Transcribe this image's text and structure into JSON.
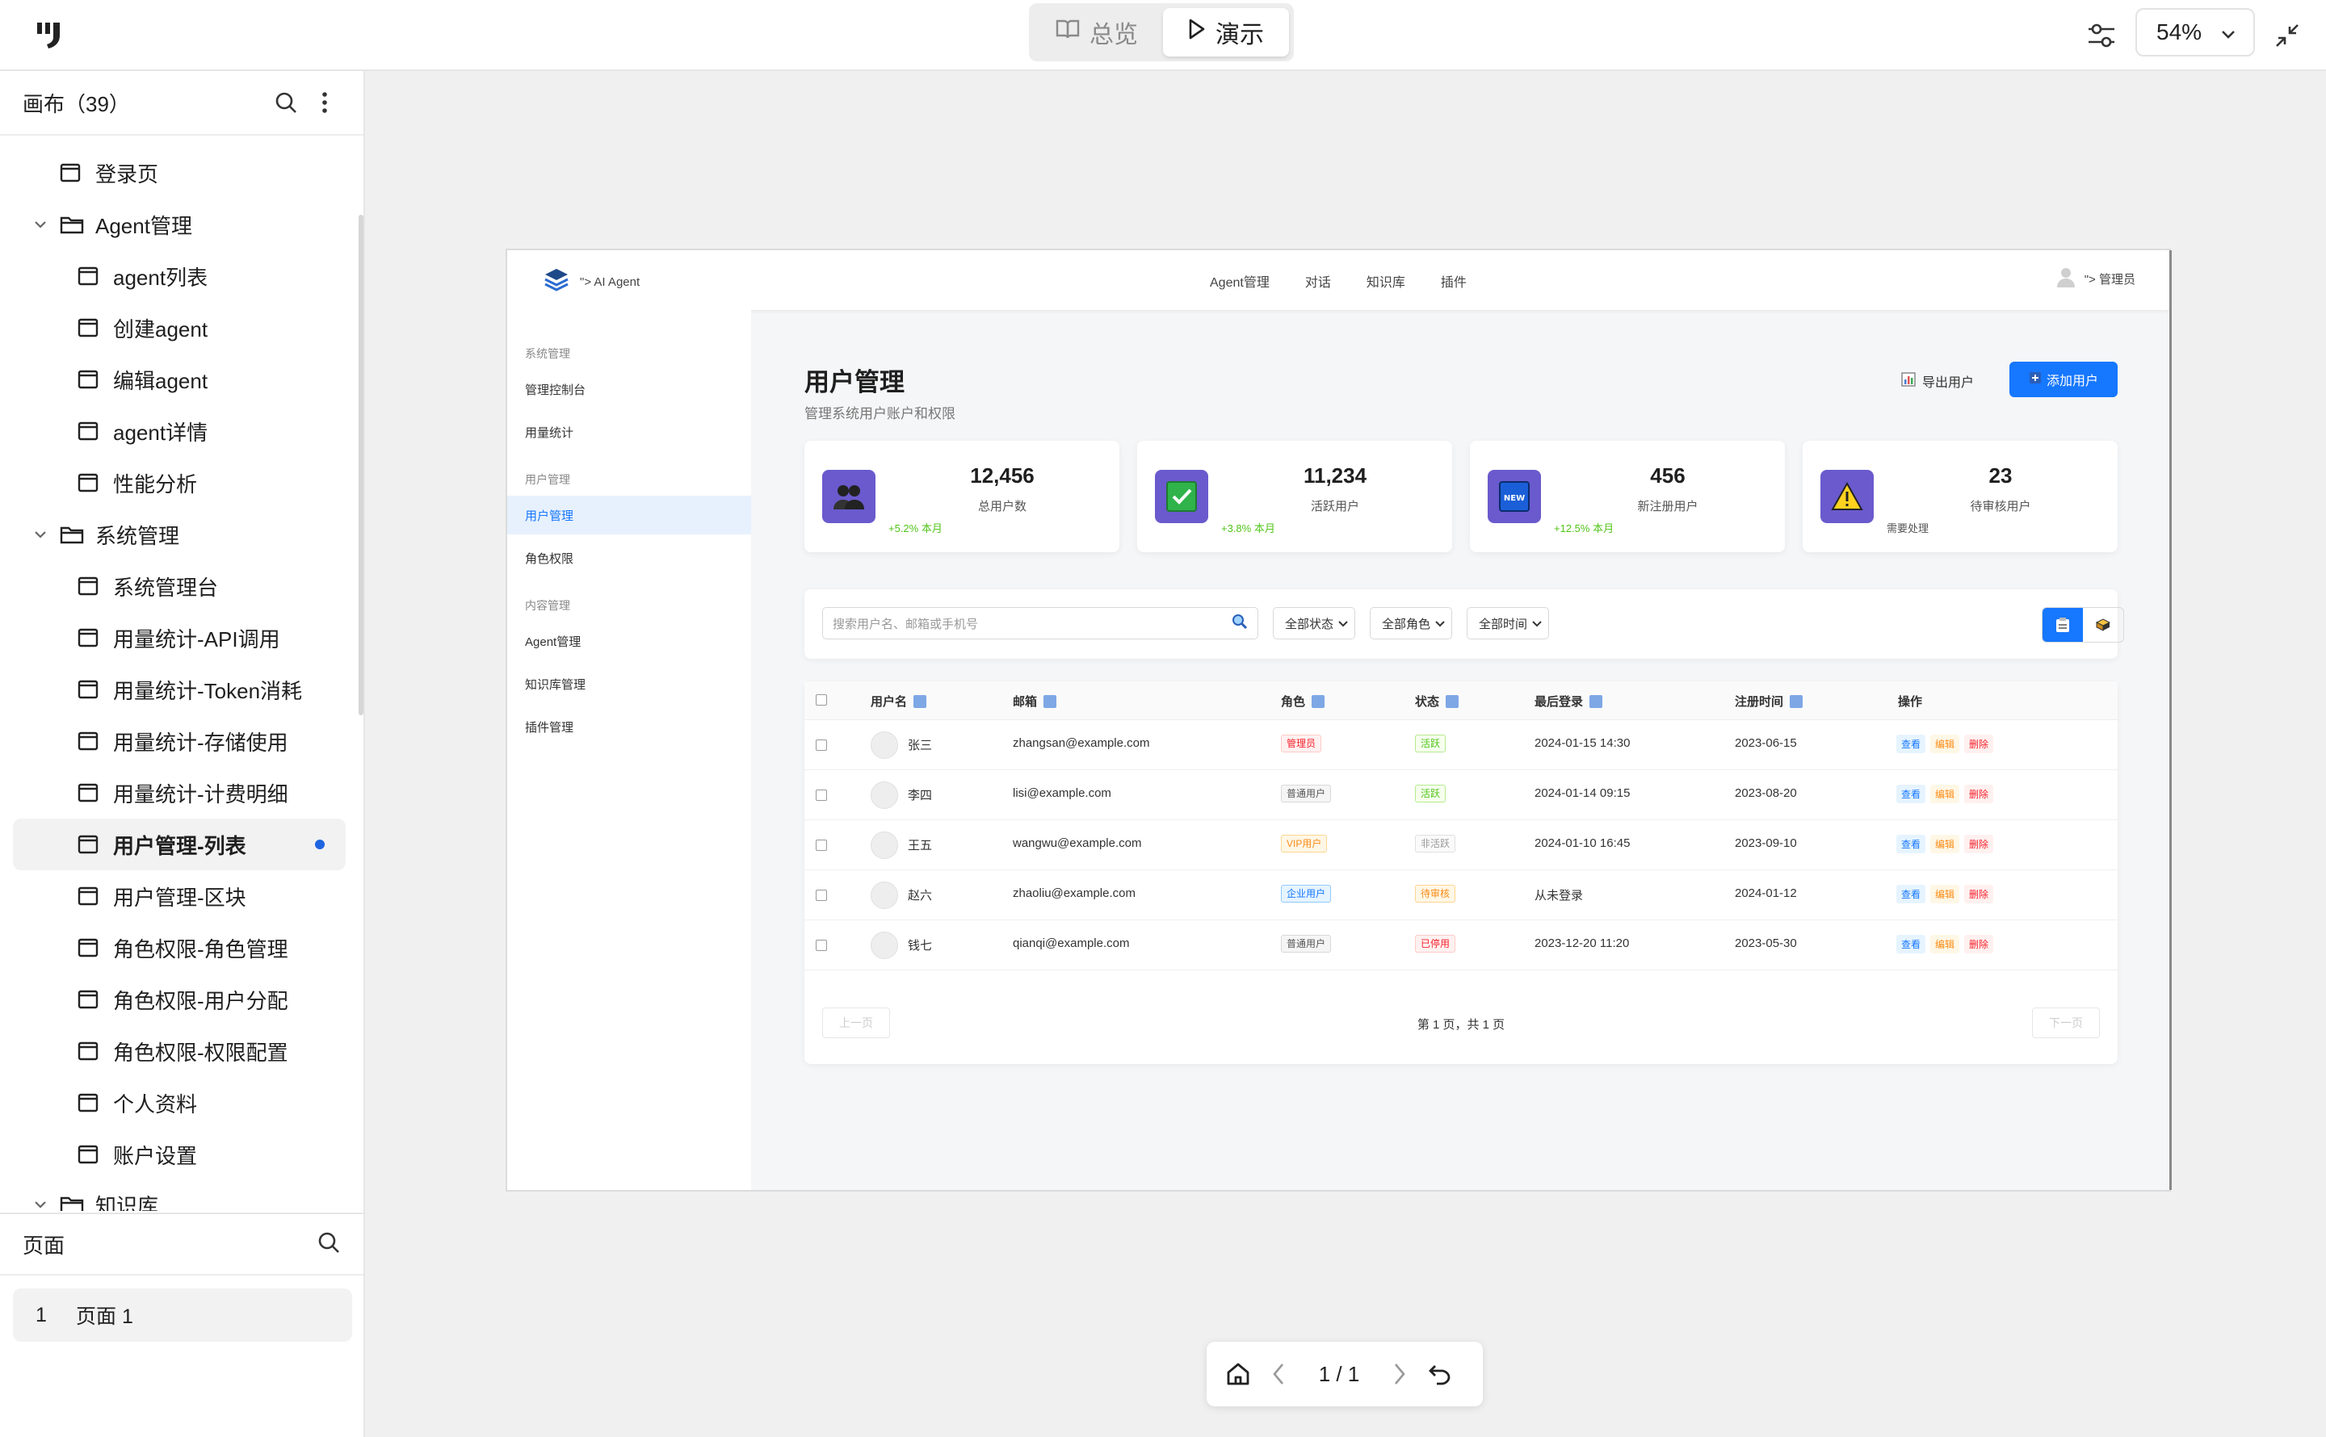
{
  "toolbar": {
    "overview_label": "总览",
    "present_label": "演示",
    "zoom": "54%"
  },
  "sidebar": {
    "canvas_title": "画布（39）",
    "tree": [
      {
        "label": "登录页",
        "type": "page",
        "level": 1
      },
      {
        "label": "Agent管理",
        "type": "folder",
        "level": 0
      },
      {
        "label": "agent列表",
        "type": "page",
        "level": 2
      },
      {
        "label": "创建agent",
        "type": "page",
        "level": 2
      },
      {
        "label": "编辑agent",
        "type": "page",
        "level": 2
      },
      {
        "label": "agent详情",
        "type": "page",
        "level": 2
      },
      {
        "label": "性能分析",
        "type": "page",
        "level": 2
      },
      {
        "label": "系统管理",
        "type": "folder",
        "level": 0
      },
      {
        "label": "系统管理台",
        "type": "page",
        "level": 2
      },
      {
        "label": "用量统计-API调用",
        "type": "page",
        "level": 2
      },
      {
        "label": "用量统计-Token消耗",
        "type": "page",
        "level": 2
      },
      {
        "label": "用量统计-存储使用",
        "type": "page",
        "level": 2
      },
      {
        "label": "用量统计-计费明细",
        "type": "page",
        "level": 2
      },
      {
        "label": "用户管理-列表",
        "type": "page",
        "level": 2,
        "active": true
      },
      {
        "label": "用户管理-区块",
        "type": "page",
        "level": 2
      },
      {
        "label": "角色权限-角色管理",
        "type": "page",
        "level": 2
      },
      {
        "label": "角色权限-用户分配",
        "type": "page",
        "level": 2
      },
      {
        "label": "角色权限-权限配置",
        "type": "page",
        "level": 2
      },
      {
        "label": "个人资料",
        "type": "page",
        "level": 2
      },
      {
        "label": "账户设置",
        "type": "page",
        "level": 2
      },
      {
        "label": "知识库",
        "type": "folder",
        "level": 0
      }
    ],
    "pages_title": "页面",
    "pages": [
      {
        "num": "1",
        "label": "页面 1"
      }
    ]
  },
  "artboard": {
    "brand": "\"> AI Agent",
    "nav": [
      "Agent管理",
      "对话",
      "知识库",
      "插件"
    ],
    "user": "\"> 管理员",
    "side_groups": [
      {
        "title": "系统管理",
        "items": [
          "管理控制台",
          "用量统计"
        ]
      },
      {
        "title": "用户管理",
        "items": [
          "用户管理",
          "角色权限"
        ]
      },
      {
        "title": "内容管理",
        "items": [
          "Agent管理",
          "知识库管理",
          "插件管理"
        ]
      }
    ],
    "page_title": "用户管理",
    "page_subtitle": "管理系统用户账户和权限",
    "export_label": "导出用户",
    "add_label": "添加用户",
    "stats": [
      {
        "value": "12,456",
        "label": "总用户数",
        "change": "+5.2% 本月",
        "icon": "users-icon"
      },
      {
        "value": "11,234",
        "label": "活跃用户",
        "change": "+3.8% 本月",
        "icon": "check-icon"
      },
      {
        "value": "456",
        "label": "新注册用户",
        "change": "+12.5% 本月",
        "icon": "new-icon"
      },
      {
        "value": "23",
        "label": "待审核用户",
        "change": "需要处理",
        "icon": "warning-icon"
      }
    ],
    "search_placeholder": "搜索用户名、邮箱或手机号",
    "filters": [
      "全部状态",
      "全部角色",
      "全部时间"
    ],
    "columns": [
      "用户名",
      "邮箱",
      "角色",
      "状态",
      "最后登录",
      "注册时间",
      "操作"
    ],
    "rows": [
      {
        "name": "张三",
        "email": "zhangsan@example.com",
        "role": "管理员",
        "role_color": "red",
        "status": "活跃",
        "status_color": "green",
        "last_login": "2024-01-15 14:30",
        "registered": "2023-06-15"
      },
      {
        "name": "李四",
        "email": "lisi@example.com",
        "role": "普通用户",
        "role_color": "gray",
        "status": "活跃",
        "status_color": "green",
        "last_login": "2024-01-14 09:15",
        "registered": "2023-08-20"
      },
      {
        "name": "王五",
        "email": "wangwu@example.com",
        "role": "VIP用户",
        "role_color": "gold",
        "status": "非活跃",
        "status_color": "lgray",
        "last_login": "2024-01-10 16:45",
        "registered": "2023-09-10"
      },
      {
        "name": "赵六",
        "email": "zhaoliu@example.com",
        "role": "企业用户",
        "role_color": "blue",
        "status": "待审核",
        "status_color": "gold",
        "last_login": "从未登录",
        "registered": "2024-01-12"
      },
      {
        "name": "钱七",
        "email": "qianqi@example.com",
        "role": "普通用户",
        "role_color": "gray",
        "status": "已停用",
        "status_color": "red",
        "last_login": "2023-12-20 11:20",
        "registered": "2023-05-30"
      }
    ],
    "actions": [
      "查看",
      "编辑",
      "删除"
    ],
    "prev_label": "上一页",
    "next_label": "下一页",
    "page_info": "第 1 页，共 1 页"
  },
  "player": {
    "page_indicator": "1 / 1"
  }
}
